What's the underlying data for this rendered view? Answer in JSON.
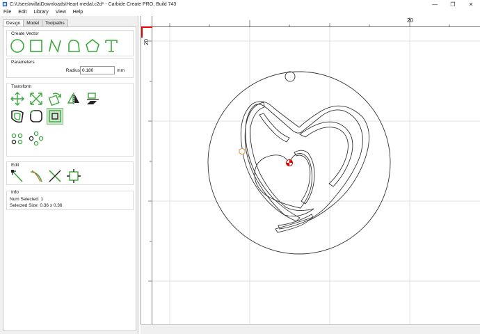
{
  "window": {
    "title": "C:\\Users\\willa\\Downloads\\Heart medal.c2d* - Carbide Create PRO, Build 743",
    "minimize_glyph": "—",
    "maximize_glyph": "❐",
    "close_glyph": "✕"
  },
  "menu": [
    "File",
    "Edit",
    "Library",
    "View",
    "Help"
  ],
  "tabs": [
    {
      "label": "Design",
      "active": true
    },
    {
      "label": "Model",
      "active": false
    },
    {
      "label": "Toolpaths",
      "active": false
    }
  ],
  "groups": {
    "create_vector": {
      "label": "Create Vector",
      "tools": [
        "circle-icon",
        "rectangle-icon",
        "polyline-icon",
        "custom-shape-icon",
        "polygon-icon",
        "text-icon"
      ]
    },
    "parameters": {
      "label": "Parameters",
      "radius_label": "Radius",
      "radius_value": "0.180",
      "radius_unit": "mm"
    },
    "transform": {
      "label": "Transform",
      "tools": [
        "move-icon",
        "scale-icon",
        "rotate-icon",
        "mirror-icon",
        "align-icon",
        "offset-icon",
        "fillet-icon",
        "boolean-icon",
        "array-icon",
        "circular-array-icon"
      ]
    },
    "edit": {
      "label": "Edit",
      "tools": [
        "node-edit-icon",
        "trim-icon",
        "cut-icon",
        "join-icon"
      ]
    },
    "info": {
      "label": "Info",
      "num_selected": "Num Selected:  1",
      "selected_size": "Selected Size:  0.36 x 0.36"
    }
  },
  "canvas": {
    "ruler_top_label": "20",
    "ruler_left_label": "20"
  },
  "colors": {
    "tool_green": "#3aa83a",
    "ruler_mark": "#e00000",
    "grid": "#d8d8d8",
    "selected_red": "#dd0000",
    "node_orange": "#e09040"
  }
}
